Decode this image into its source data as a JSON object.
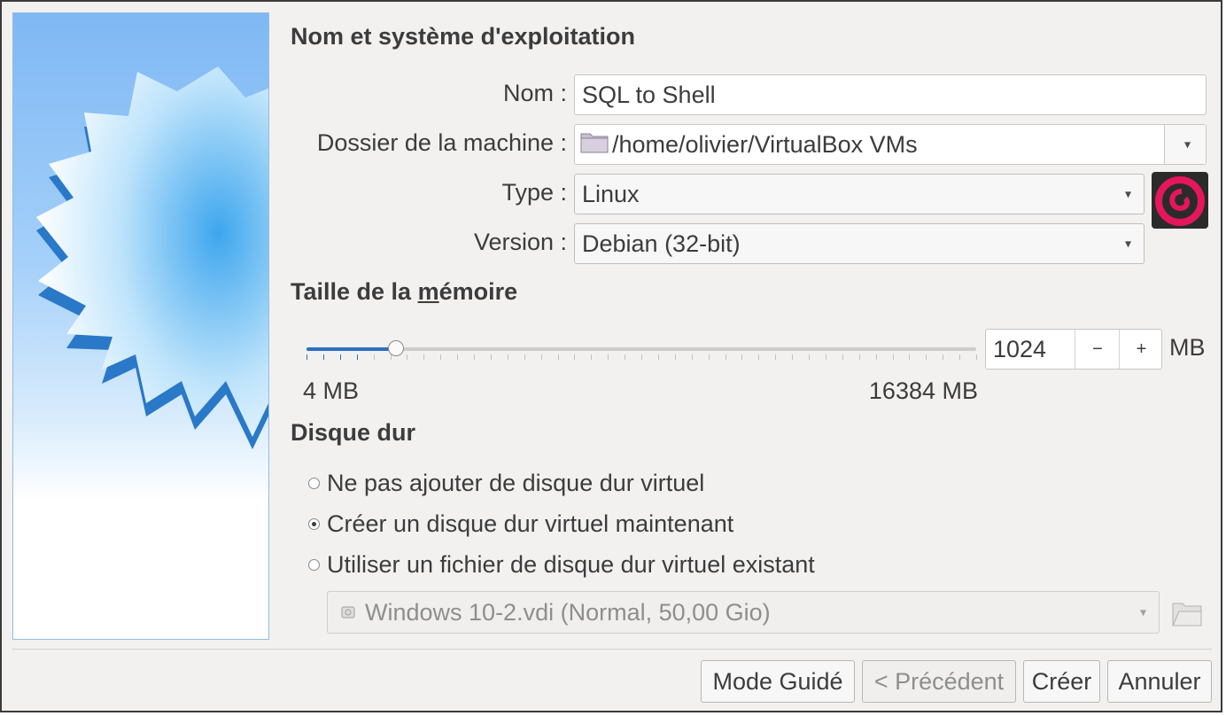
{
  "sections": {
    "name_os": "Nom et système d'exploitation",
    "memory_prefix": "Taille de la ",
    "memory_mnemonic": "m",
    "memory_suffix": "émoire",
    "disk": "Disque dur"
  },
  "fields": {
    "name_label": "Nom :",
    "name_value": "SQL to Shell",
    "folder_label": "Dossier de la machine :",
    "folder_value": "/home/olivier/VirtualBox VMs",
    "type_label": "Type :",
    "type_value": "Linux",
    "version_label": "Version :",
    "version_value": "Debian (32-bit)"
  },
  "memory": {
    "value": "1024",
    "unit": "MB",
    "min_label": "4 MB",
    "max_label": "16384 MB",
    "min": 4,
    "max": 16384,
    "current": 1024,
    "decrement": "−",
    "increment": "+"
  },
  "disk_options": [
    {
      "label": "Ne pas ajouter de disque dur virtuel",
      "checked": false
    },
    {
      "label": "Créer un disque dur virtuel maintenant",
      "checked": true
    },
    {
      "label": "Utiliser un fichier de disque dur virtuel existant",
      "checked": false
    }
  ],
  "existing_disk": {
    "value": "Windows 10-2.vdi (Normal, 50,00 Gio)"
  },
  "buttons": {
    "guided": "Mode Guidé",
    "previous": "< Précédent",
    "create": "Créer",
    "cancel": "Annuler"
  },
  "icons": {
    "folder": "folder-icon",
    "os_logo": "debian-logo-icon",
    "disk": "hard-disk-icon",
    "browse": "browse-folder-icon",
    "dropdown": "chevron-down-icon"
  },
  "colors": {
    "accent": "#2f6fc4",
    "debian_red": "#d70a53",
    "dialog_bg": "#f2f1f0"
  }
}
